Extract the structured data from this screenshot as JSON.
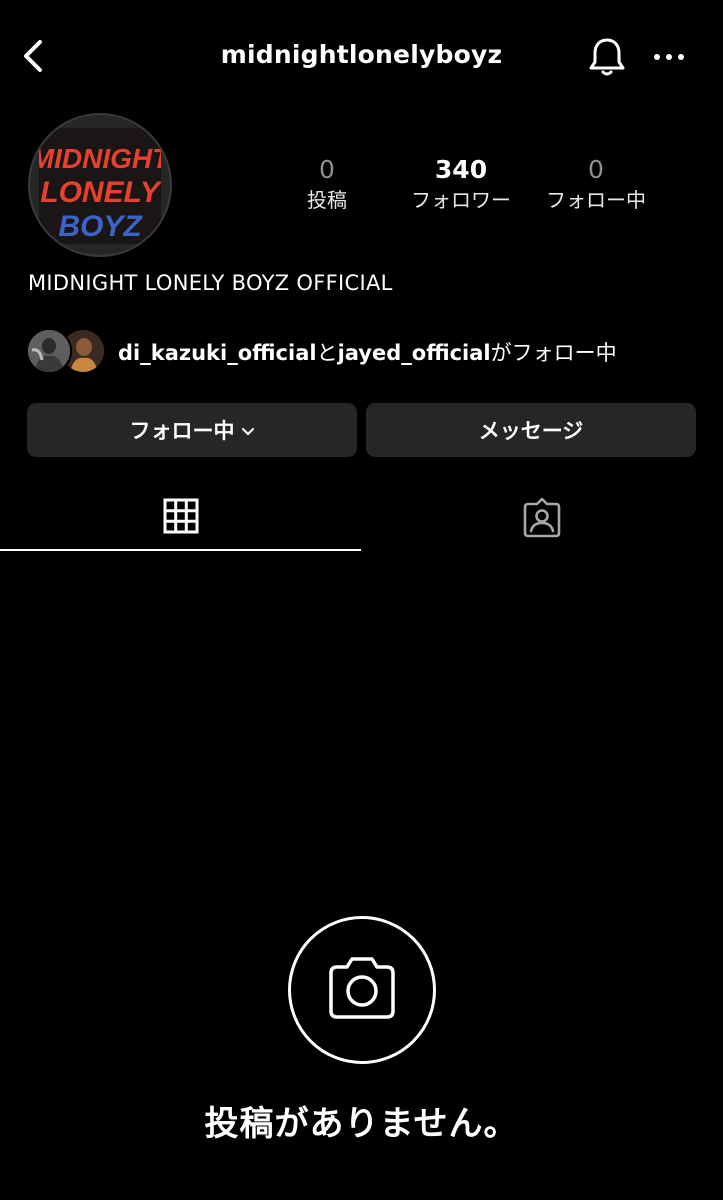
{
  "header": {
    "username": "midnightlonelyboyz"
  },
  "profile": {
    "logo_lines": [
      "MIDNIGHT",
      "LONELY",
      "BOYZ"
    ],
    "display_name": "MIDNIGHT LONELY BOYZ OFFICIAL",
    "stats": {
      "posts": {
        "count": "0",
        "label": "投稿"
      },
      "followers": {
        "count": "340",
        "label": "フォロワー"
      },
      "following": {
        "count": "0",
        "label": "フォロー中"
      }
    },
    "followed_by": {
      "user1": "di_kazuki_official",
      "connector": "と",
      "user2": "jayed_official",
      "suffix": "がフォロー中"
    }
  },
  "actions": {
    "following_label": "フォロー中",
    "message_label": "メッセージ"
  },
  "tabs": [
    {
      "name": "grid",
      "icon": "grid-icon",
      "active": true
    },
    {
      "name": "tagged",
      "icon": "tagged-person-icon",
      "active": false
    }
  ],
  "empty_state": {
    "icon": "camera-icon",
    "text": "投稿がありません。"
  },
  "colors": {
    "background": "#000000",
    "button_bg": "#262626",
    "muted_text": "#8e8e8e",
    "logo_red": "#e8402f",
    "logo_blue": "#3b63c9"
  }
}
